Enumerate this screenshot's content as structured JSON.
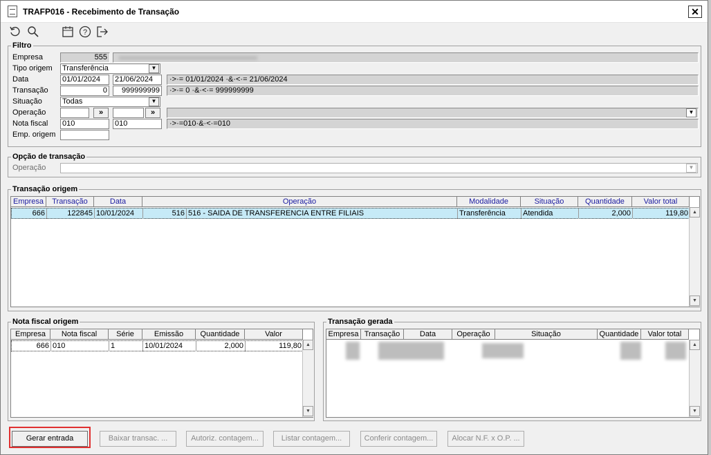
{
  "window": {
    "title": "TRAFP016 - Recebimento de Transação"
  },
  "toolbar": {
    "icons": [
      "undo-icon",
      "search-icon",
      "calendar-icon",
      "help-icon",
      "exit-icon"
    ]
  },
  "filtro": {
    "title": "Filtro",
    "empresa_label": "Empresa",
    "empresa_value": "555",
    "tipo_origem_label": "Tipo origem",
    "tipo_origem_value": "Transferência",
    "data_label": "Data",
    "data_from": "01/01/2024",
    "data_to": "21/06/2024",
    "data_expr": "·>·= 01/01/2024 ·&·<·= 21/06/2024",
    "transacao_label": "Transação",
    "transacao_from": "0",
    "transacao_to": "999999999",
    "transacao_expr": "·>·= 0 ·&·<·= 999999999",
    "situacao_label": "Situação",
    "situacao_value": "Todas",
    "operacao_label": "Operação",
    "operacao_btn": "»",
    "nota_fiscal_label": "Nota fiscal",
    "nota_fiscal_from": "010",
    "nota_fiscal_to": "010",
    "nota_fiscal_expr": "·>·=010·&·<·=010",
    "emp_origem_label": "Emp. origem"
  },
  "opcao": {
    "title": "Opção de transação",
    "operacao_label": "Operação"
  },
  "origem": {
    "title": "Transação origem",
    "columns": [
      "Empresa",
      "Transação",
      "Data",
      "Operação",
      "Modalidade",
      "Situação",
      "Quantidade",
      "Valor total"
    ],
    "rows": [
      {
        "empresa": "666",
        "transacao": "122845",
        "data": "10/01/2024",
        "op_code": "516",
        "operacao": "516 - SAIDA DE TRANSFERENCIA ENTRE FILIAIS",
        "modalidade": "Transferência",
        "situacao": "Atendida",
        "quantidade": "2,000",
        "valor_total": "119,80"
      }
    ]
  },
  "nota_fiscal": {
    "title": "Nota fiscal origem",
    "columns": [
      "Empresa",
      "Nota fiscal",
      "Série",
      "Emissão",
      "Quantidade",
      "Valor"
    ],
    "rows": [
      {
        "empresa": "666",
        "nota_fiscal": "010",
        "serie": "1",
        "emissao": "10/01/2024",
        "quantidade": "2,000",
        "valor": "119,80"
      }
    ]
  },
  "gerada": {
    "title": "Transação gerada",
    "columns": [
      "Empresa",
      "Transação",
      "Data",
      "Operação",
      "Situação",
      "Quantidade",
      "Valor total"
    ]
  },
  "buttons": {
    "gerar": "Gerar entrada",
    "baixar": "Baixar transac. ...",
    "autoriz": "Autoriz. contagem...",
    "listar": "Listar contagem...",
    "conferir": "Conferir contagem...",
    "alocar": "Alocar N.F. x O.P. ..."
  },
  "colors": {
    "highlight": "#e03030",
    "selected_row": "#c6eaf7",
    "header_text": "#1a1aa0"
  }
}
